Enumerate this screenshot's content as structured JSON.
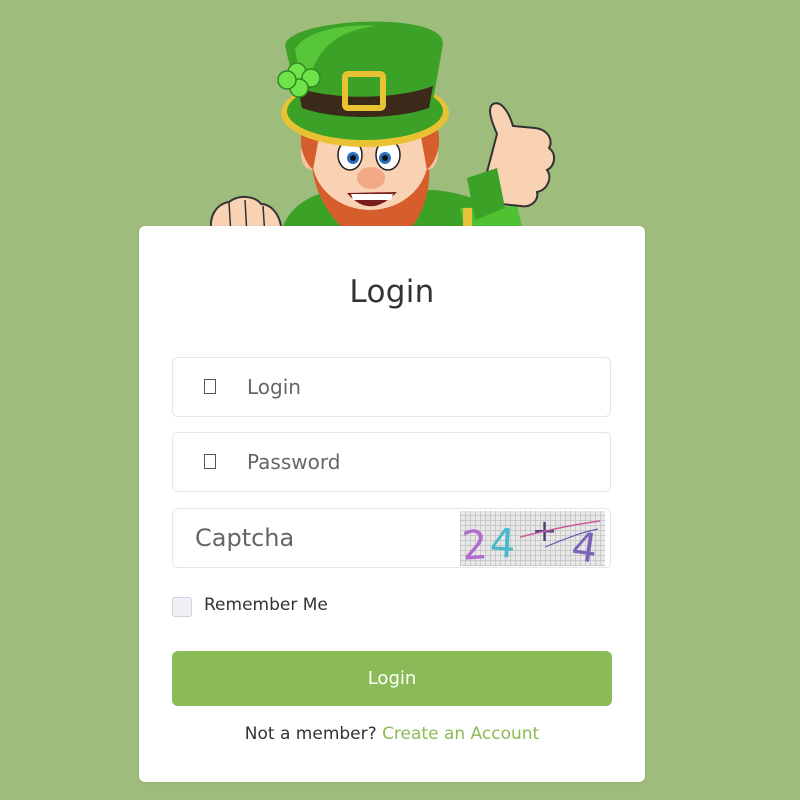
{
  "colors": {
    "background": "#9ebc7c",
    "accent": "#8bbb57",
    "card": "#ffffff"
  },
  "mascot": {
    "icon": "leprechaun-thumbs-up-icon"
  },
  "form": {
    "title": "Login",
    "login_field": {
      "placeholder": "Login",
      "icon": "user-icon"
    },
    "password_field": {
      "placeholder": "Password",
      "icon": "lock-icon"
    },
    "captcha_field": {
      "placeholder": "Captcha"
    },
    "captcha_image": {
      "text": "24+4"
    },
    "remember_label": "Remember Me",
    "remember_checked": false,
    "submit_label": "Login",
    "signup_prompt": "Not a member?",
    "signup_link": "Create an Account"
  }
}
